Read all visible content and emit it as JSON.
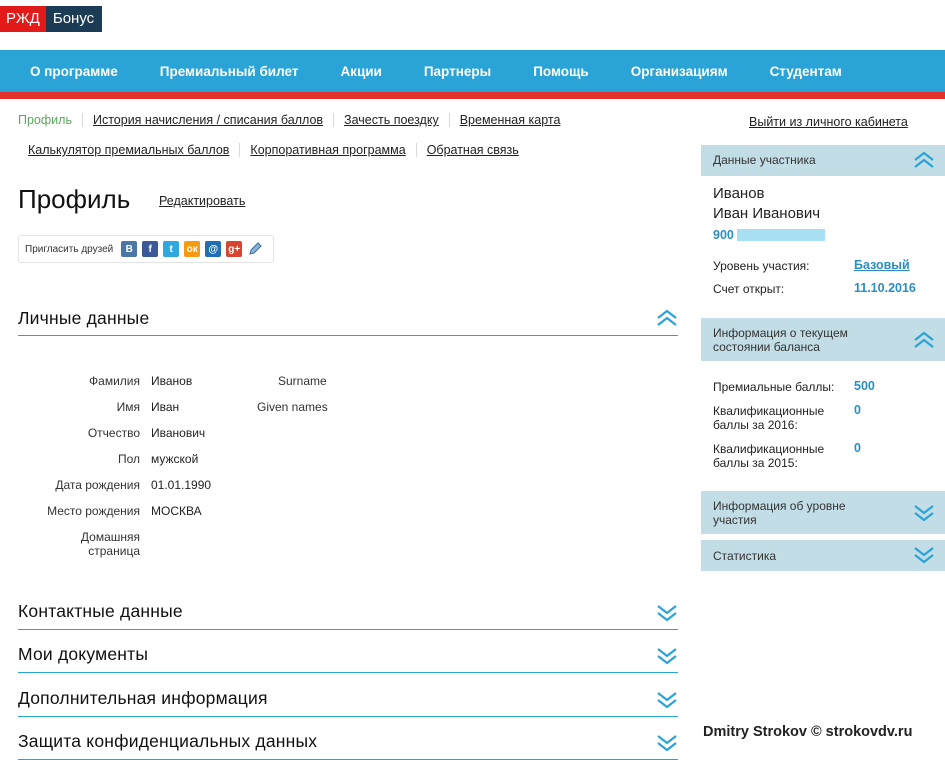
{
  "logo": {
    "left": "РЖД",
    "right": "Бонус"
  },
  "topnav": [
    "О программе",
    "Премиальный билет",
    "Акции",
    "Партнеры",
    "Помощь",
    "Организациям",
    "Студентам"
  ],
  "subnav_row1": [
    "Профиль",
    "История начисления / списания баллов",
    "Зачесть поездку",
    "Временная карта"
  ],
  "subnav_row2": [
    "Калькулятор премиальных баллов",
    "Корпоративная программа",
    "Обратная связь"
  ],
  "logout": "Выйти из личного кабинета",
  "page": {
    "title": "Профиль",
    "edit": "Редактировать",
    "invite": "Пригласить друзей"
  },
  "social_icons": [
    "vk-icon",
    "facebook-icon",
    "twitter-icon",
    "odnoklassniki-icon",
    "mail-icon",
    "google-plus-icon",
    "livejournal-icon"
  ],
  "sections": {
    "personal": "Личные данные",
    "contacts": "Контактные данные",
    "documents": "Мои документы",
    "additional": "Дополнительная информация",
    "privacy": "Защита конфиденциальных данных"
  },
  "personal": {
    "surname_label": "Фамилия",
    "surname": "Иванов",
    "surname_en_label": "Surname",
    "name_label": "Имя",
    "name": "Иван",
    "given_en_label": "Given names",
    "patronymic_label": "Отчество",
    "patronymic": "Иванович",
    "gender_label": "Пол",
    "gender": "мужской",
    "birthdate_label": "Дата рождения",
    "birthdate": "01.01.1990",
    "birthplace_label": "Место рождения",
    "birthplace": "МОСКВА",
    "homepage_label_1": "Домашняя",
    "homepage_label_2": "страница"
  },
  "sidebar": {
    "participant_title": "Данные участника",
    "surname": "Иванов",
    "name": "Иван Иванович",
    "account_prefix": "900",
    "level_label": "Уровень участия:",
    "level": "Базовый",
    "opened_label": "Счет открыт:",
    "opened": "11.10.2016",
    "balance_title_1": "Информация о текущем",
    "balance_title_2": "состоянии баланса",
    "premium_label": "Премиальные баллы:",
    "premium": "500",
    "qual2016_label_1": "Квалификационные",
    "qual2016_label_2": "баллы за 2016:",
    "qual2016": "0",
    "qual2015_label_1": "Квалификационные",
    "qual2015_label_2": "баллы за 2015:",
    "qual2015": "0",
    "level_info_1": "Информация об уровне",
    "level_info_2": "участия",
    "stats": "Статистика"
  },
  "colors": {
    "nav": "#2aa3d6",
    "red": "#e2322a",
    "sidebar": "#c2dde6",
    "accent": "#2a8fc0",
    "active": "#5ba85b"
  },
  "watermark": "Dmitry Strokov © strokovdv.ru"
}
